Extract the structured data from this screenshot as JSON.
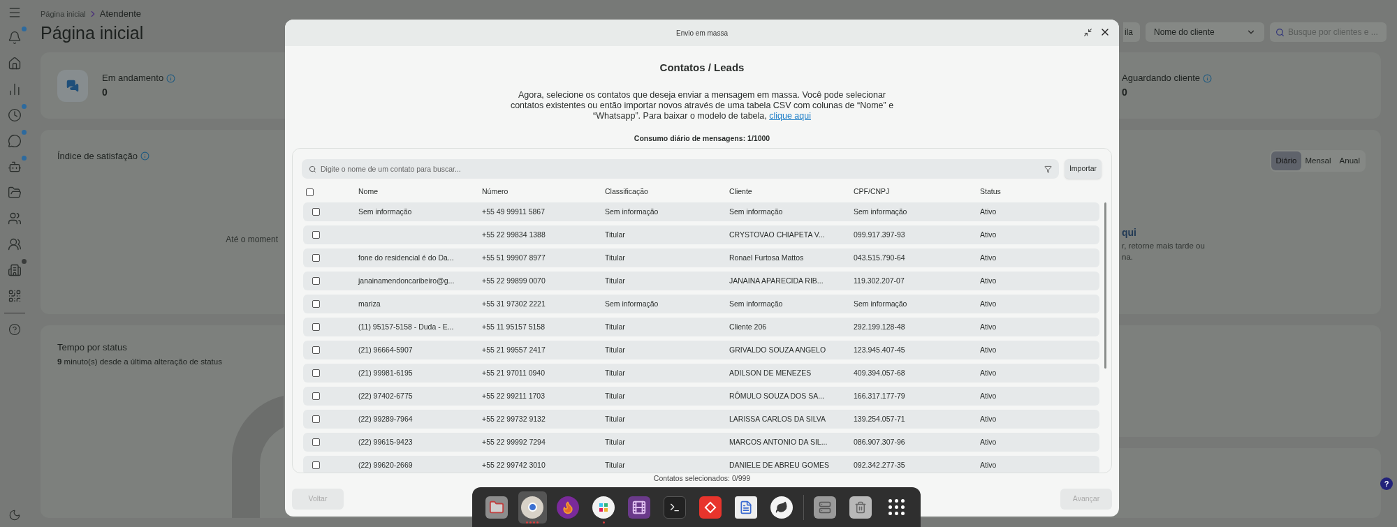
{
  "sidebar": {
    "items": [
      {
        "badge": true,
        "color": "#2d6a9e"
      },
      {
        "badge": false
      },
      {
        "badge": false
      },
      {
        "badge": true,
        "color": "#2d6a9e"
      },
      {
        "badge": true,
        "color": "#2d6a9e"
      },
      {
        "badge": true,
        "color": "#2d6a9e"
      },
      {
        "badge": false
      },
      {
        "badge": false
      },
      {
        "badge": false
      },
      {
        "badge": true,
        "color": "#3a3c3b"
      },
      {
        "badge": false
      }
    ]
  },
  "header": {
    "breadcrumb": [
      "Página inicial",
      "Atendente"
    ],
    "title": "Página inicial",
    "queue_button": "ila",
    "client_select": "Nome do cliente",
    "search_placeholder": "Busque por clientes e ..."
  },
  "stats": [
    {
      "label": "Em andamento",
      "value": "0"
    },
    {
      "label": "Aguardando cliente",
      "value": "0"
    }
  ],
  "satisfaction": {
    "title": "Índice de satisfação",
    "periods": [
      {
        "label": "Diário",
        "selected": true
      },
      {
        "label": "Mensal",
        "selected": false
      },
      {
        "label": "Anual",
        "selected": false
      }
    ],
    "empty_left": "Até o moment",
    "empty_heading": "qui",
    "empty_lines": [
      "r, retorne mais tarde ou",
      "na."
    ]
  },
  "status_time": {
    "title": "Tempo por status",
    "subtitle": "**9** minuto(s) desde a última alteração de status"
  },
  "help_button": "?",
  "modal": {
    "title": "Envio em massa",
    "heading": "Contatos / Leads",
    "intro": "Agora, selecione os contatos que deseja enviar a mensagem em massa. Você pode selecionar contatos existentes ou então importar novos através de uma tabela CSV com colunas de “Nome” e “Whatsapp”. Para baixar o modelo de tabela,",
    "link": "clique aqui",
    "usage": "Consumo diário de mensagens: 1/1000",
    "search_placeholder": "Digite o nome de um contato para buscar...",
    "import_button": "Importar",
    "columns": [
      "Nome",
      "Número",
      "Classificação",
      "Cliente",
      "CPF/CNPJ",
      "Status"
    ],
    "select_all": false,
    "rows": [
      {
        "checked": false,
        "cells": [
          "Sem informação",
          "+55 49 99911 5867",
          "Sem informação",
          "Sem informação",
          "Sem informação",
          "Ativo"
        ]
      },
      {
        "checked": false,
        "cells": [
          "",
          "+55 22 99834 1388",
          "Titular",
          "CRYSTOVAO CHIAPETA V...",
          "099.917.397-93",
          "Ativo"
        ]
      },
      {
        "checked": false,
        "cells": [
          "fone do residencial é do Da...",
          "+55 51 99907 8977",
          "Titular",
          "Ronael Furtosa Mattos",
          "043.515.790-64",
          "Ativo"
        ]
      },
      {
        "checked": false,
        "cells": [
          "janainamendoncaribeiro@g...",
          "+55 22 99899 0070",
          "Titular",
          "JANAINA APARECIDA RIB...",
          "119.302.207-07",
          "Ativo"
        ]
      },
      {
        "checked": false,
        "cells": [
          "mariza",
          "+55 31 97302 2221",
          "Sem informação",
          "Sem informação",
          "Sem informação",
          "Ativo"
        ]
      },
      {
        "checked": false,
        "cells": [
          "(11) 95157-5158 - Duda - E...",
          "+55 11 95157 5158",
          "Titular",
          "Cliente 206",
          "292.199.128-48",
          "Ativo"
        ]
      },
      {
        "checked": false,
        "cells": [
          "(21) 96664-5907",
          "+55 21 99557 2417",
          "Titular",
          "GRIVALDO SOUZA ANGELO",
          "123.945.407-45",
          "Ativo"
        ]
      },
      {
        "checked": false,
        "cells": [
          "(21) 99981-6195",
          "+55 21 97011 0940",
          "Titular",
          "ADILSON DE MENEZES",
          "409.394.057-68",
          "Ativo"
        ]
      },
      {
        "checked": false,
        "cells": [
          "(22) 97402-6775",
          "+55 22 99211 1703",
          "Titular",
          "RÔMULO SOUZA DOS SA...",
          "166.317.177-79",
          "Ativo"
        ]
      },
      {
        "checked": false,
        "cells": [
          "(22) 99289-7964",
          "+55 22 99732 9132",
          "Titular",
          "LARISSA CARLOS DA SILVA",
          "139.254.057-71",
          "Ativo"
        ]
      },
      {
        "checked": false,
        "cells": [
          "(22) 99615-9423",
          "+55 22 99992 7294",
          "Titular",
          "MARCOS ANTONIO DA SIL...",
          "086.907.307-96",
          "Ativo"
        ]
      },
      {
        "checked": false,
        "cells": [
          "(22) 99620-2669",
          "+55 22 99742 3010",
          "Titular",
          "DANIELE DE ABREU GOMES",
          "092.342.277-35",
          "Ativo"
        ]
      }
    ],
    "selected_count": "Contatos selecionados: 0/999",
    "back_button": {
      "label": "Voltar",
      "disabled": true
    },
    "next_button": {
      "label": "Avançar",
      "disabled": true
    }
  },
  "dock": {
    "apps": [
      {
        "running": false,
        "active": false
      },
      {
        "running": true,
        "active": true
      },
      {
        "running": false,
        "active": false
      },
      {
        "running": true,
        "active": false
      },
      {
        "running": false,
        "active": false
      },
      {
        "running": false,
        "active": false
      },
      {
        "running": false,
        "active": false
      },
      {
        "running": false,
        "active": false
      },
      {
        "running": false,
        "active": false
      },
      {
        "running": false,
        "active": false
      },
      {
        "running": false,
        "active": false
      },
      {
        "running": false,
        "active": false
      }
    ]
  }
}
